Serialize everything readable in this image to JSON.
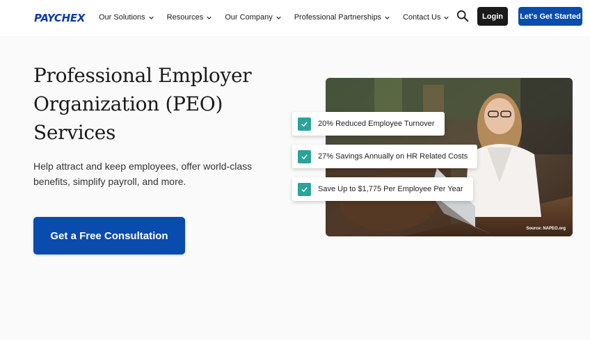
{
  "brand": {
    "logo": "PAYCHEX",
    "color": "#0a3ba8"
  },
  "nav": {
    "items": [
      {
        "label": "Our Solutions"
      },
      {
        "label": "Resources"
      },
      {
        "label": "Our Company"
      },
      {
        "label": "Professional Partnerships"
      },
      {
        "label": "Contact Us"
      }
    ],
    "search_icon": "search-icon",
    "login_label": "Login",
    "cta_label": "Let's Get Started"
  },
  "hero": {
    "title": "Professional Employer Organization (PEO) Services",
    "description": "Help attract and keep employees, offer world-class benefits, simplify payroll, and more.",
    "button_label": "Get a Free Consultation"
  },
  "stats": [
    {
      "text": "20% Reduced Employee Turnover"
    },
    {
      "text": "27% Savings Annually on HR Related Costs"
    },
    {
      "text": "Save Up to $1,775 Per Employee Per Year"
    }
  ],
  "photo": {
    "source": "Source: NAPEO.org"
  },
  "colors": {
    "primary": "#0a4cad",
    "check": "#2aa39a",
    "dark": "#1a1a1a"
  }
}
